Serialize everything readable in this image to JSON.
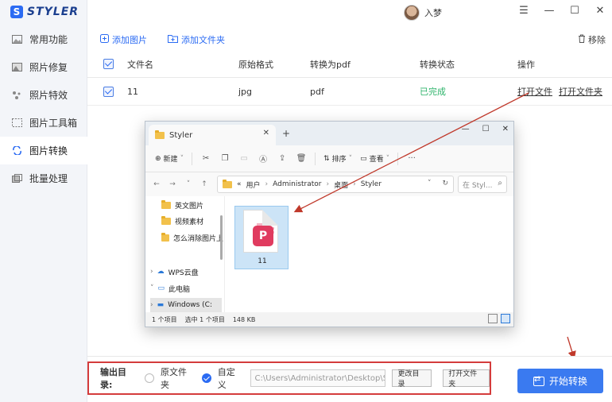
{
  "app": {
    "logo_letter": "S",
    "name": "STYLER"
  },
  "user": {
    "name": "入梦"
  },
  "window_controls": [
    "☰",
    "—",
    "☐",
    "✕"
  ],
  "sidebar": {
    "items": [
      {
        "label": "常用功能",
        "icon": "image-icon"
      },
      {
        "label": "照片修复",
        "icon": "photo-repair-icon"
      },
      {
        "label": "照片特效",
        "icon": "sparkle-icon"
      },
      {
        "label": "图片工具箱",
        "icon": "toolbox-icon"
      },
      {
        "label": "图片转换",
        "icon": "convert-icon",
        "active": true
      },
      {
        "label": "批量处理",
        "icon": "batch-icon"
      }
    ]
  },
  "toolbar": {
    "add_image": "添加图片",
    "add_folder": "添加文件夹",
    "remove": "移除"
  },
  "table": {
    "headers": [
      "文件名",
      "原始格式",
      "转换为pdf",
      "转换状态",
      "操作"
    ],
    "rows": [
      {
        "name": "11",
        "src_format": "jpg",
        "target": "pdf",
        "status": "已完成",
        "open_file": "打开文件",
        "open_folder": "打开文件夹"
      }
    ]
  },
  "explorer": {
    "tab_title": "Styler",
    "commands": {
      "new": "新建",
      "sort": "排序",
      "view": "查看"
    },
    "address": {
      "prefix": "«",
      "crumbs": [
        "用户",
        "Administrator",
        "桌面",
        "Styler"
      ]
    },
    "search_placeholder": "在 Styl...",
    "nav_items": [
      "英文图片",
      "视频素材",
      "怎么消除图片上",
      "WPS云盘",
      "此电脑",
      "Windows (C:"
    ],
    "file": {
      "name": "11",
      "badge": "P"
    },
    "status": {
      "count": "1 个项目",
      "selected": "选中 1 个项目",
      "size": "148 KB"
    }
  },
  "bottom": {
    "output_label": "输出目录:",
    "option_original": "原文件夹",
    "option_custom": "自定义",
    "path_value": "C:\\Users\\Administrator\\Desktop\\Styl",
    "change_dir": "更改目录",
    "open_folder": "打开文件夹",
    "start": "开始转换"
  },
  "colors": {
    "accent": "#3a7af0",
    "done": "#2db36a",
    "annotation": "#c0392b"
  }
}
